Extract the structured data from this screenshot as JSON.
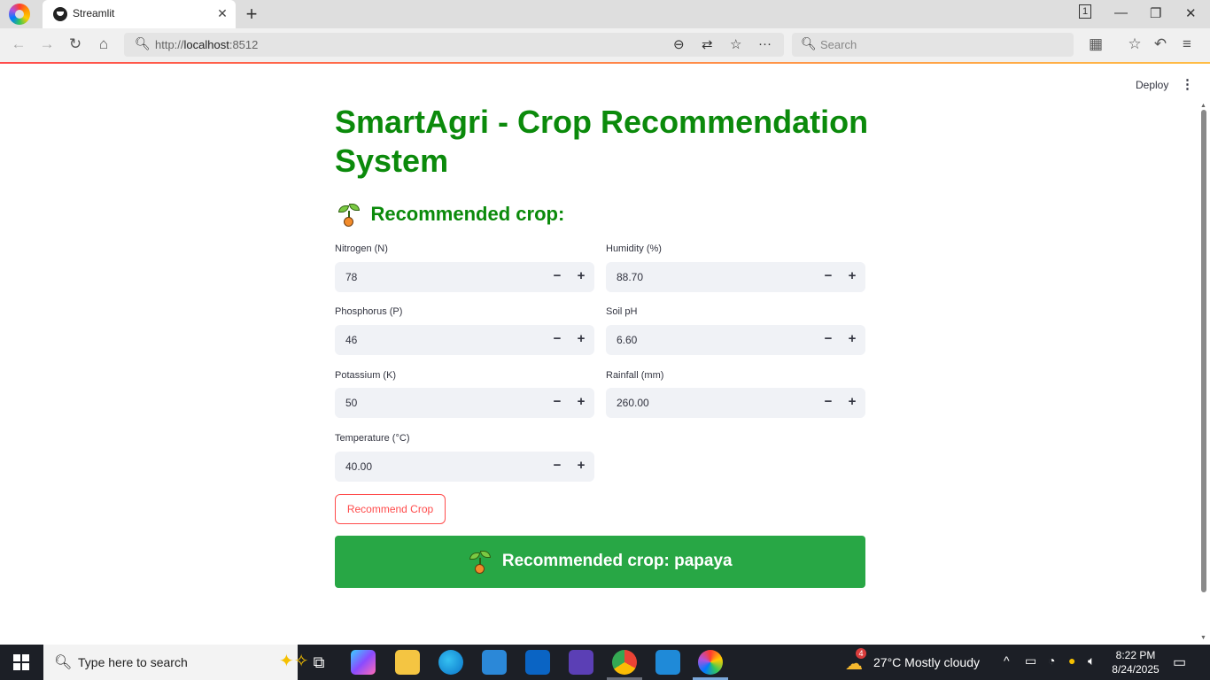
{
  "browser": {
    "tab_title": "Streamlit",
    "url_prefix": "http://",
    "url_host": "localhost",
    "url_port": ":8512",
    "search_placeholder": "Search",
    "tab_count": "1"
  },
  "app": {
    "deploy_label": "Deploy",
    "title": "SmartAgri - Crop Recommendation System",
    "subheader": "Recommended crop:",
    "fields": {
      "nitrogen": {
        "label": "Nitrogen (N)",
        "value": "78"
      },
      "phosphorus": {
        "label": "Phosphorus (P)",
        "value": "46"
      },
      "potassium": {
        "label": "Potassium (K)",
        "value": "50"
      },
      "temperature": {
        "label": "Temperature (°C)",
        "value": "40.00"
      },
      "humidity": {
        "label": "Humidity (%)",
        "value": "88.70"
      },
      "ph": {
        "label": "Soil pH",
        "value": "6.60"
      },
      "rainfall": {
        "label": "Rainfall (mm)",
        "value": "260.00"
      }
    },
    "button_label": "Recommend Crop",
    "result": "Recommended crop: papaya",
    "colors": {
      "title": "#0b8a0b",
      "result_bg": "#28a745",
      "button_accent": "#ff4b4b"
    }
  },
  "taskbar": {
    "search_placeholder": "Type here to search",
    "weather": "27°C  Mostly cloudy",
    "weather_badge": "4",
    "time": "8:22 PM",
    "date": "8/24/2025"
  }
}
